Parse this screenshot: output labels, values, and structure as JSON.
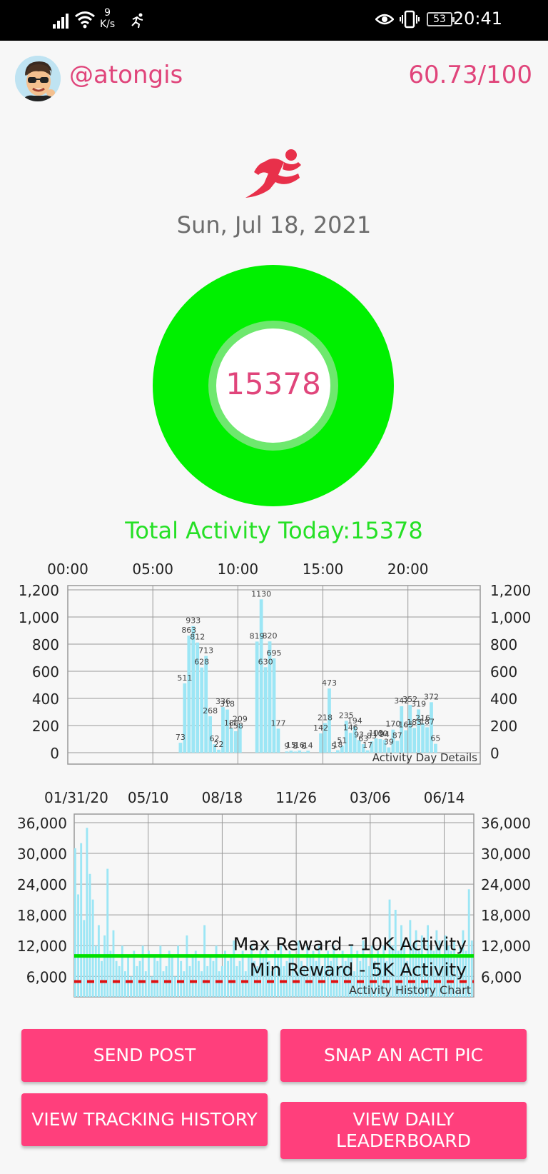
{
  "status_bar": {
    "net_speed_value": "9",
    "net_speed_unit": "K/s",
    "battery": "53",
    "time": "20:41",
    "icons": [
      "signal-icon",
      "wifi-icon",
      "running-notification-icon",
      "eye-icon",
      "vibrate-icon",
      "battery-icon"
    ]
  },
  "header": {
    "username": "@atongis",
    "score": "60.73/100",
    "avatar_icon": "avatar-cartoon-face"
  },
  "activity_icon": "running-person-icon",
  "date": "Sun, Jul 18, 2021",
  "ring": {
    "value": "15378",
    "color": "#00f000",
    "inner_color": "#6ee86e"
  },
  "total_label": "Total Activity Today:15378",
  "colors": {
    "accent": "#ff3f7c",
    "text_pink": "#e0457b",
    "green": "#25e025",
    "bar": "#9ce6f5",
    "red_dash": "#e01010"
  },
  "chart_data": [
    {
      "type": "bar",
      "caption": "Activity Day Details",
      "x_ticks": [
        "00:00",
        "05:00",
        "10:00",
        "15:00",
        "20:00"
      ],
      "y_ticks": [
        "1,200",
        "1,000",
        "800",
        "600",
        "400",
        "200",
        "0"
      ],
      "ylim": [
        0,
        1200
      ],
      "grid": true,
      "values": [
        0,
        0,
        0,
        0,
        0,
        0,
        0,
        0,
        0,
        0,
        0,
        0,
        0,
        0,
        0,
        0,
        0,
        0,
        0,
        0,
        0,
        0,
        0,
        0,
        0,
        0,
        73,
        511,
        863,
        933,
        812,
        628,
        713,
        268,
        62,
        22,
        336,
        318,
        180,
        158,
        209,
        0,
        0,
        0,
        819,
        1130,
        630,
        820,
        695,
        177,
        0,
        9,
        15,
        8,
        16,
        6,
        14,
        0,
        0,
        142,
        218,
        473,
        5,
        18,
        51,
        235,
        146,
        194,
        93,
        63,
        17,
        83,
        105,
        100,
        94,
        39,
        170,
        87,
        342,
        165,
        352,
        183,
        319,
        216,
        187,
        372,
        65,
        0,
        0,
        0,
        0,
        0,
        0,
        0,
        0,
        0,
        0
      ],
      "labels": [
        {
          "i": 26,
          "t": "73"
        },
        {
          "i": 27,
          "t": "511"
        },
        {
          "i": 28,
          "t": "863"
        },
        {
          "i": 29,
          "t": "933"
        },
        {
          "i": 30,
          "t": "812"
        },
        {
          "i": 31,
          "t": "628"
        },
        {
          "i": 32,
          "t": "713"
        },
        {
          "i": 33,
          "t": "268"
        },
        {
          "i": 34,
          "t": "62"
        },
        {
          "i": 35,
          "t": "22"
        },
        {
          "i": 36,
          "t": "336"
        },
        {
          "i": 37,
          "t": "318"
        },
        {
          "i": 38,
          "t": "180"
        },
        {
          "i": 39,
          "t": "158"
        },
        {
          "i": 40,
          "t": "209"
        },
        {
          "i": 44,
          "t": "819"
        },
        {
          "i": 45,
          "t": "1130"
        },
        {
          "i": 46,
          "t": "630"
        },
        {
          "i": 47,
          "t": "820"
        },
        {
          "i": 48,
          "t": "695"
        },
        {
          "i": 49,
          "t": "177"
        },
        {
          "i": 51,
          "t": "9"
        },
        {
          "i": 52,
          "t": "15"
        },
        {
          "i": 53,
          "t": "8"
        },
        {
          "i": 54,
          "t": "16"
        },
        {
          "i": 55,
          "t": "6"
        },
        {
          "i": 56,
          "t": "14"
        },
        {
          "i": 59,
          "t": "142"
        },
        {
          "i": 60,
          "t": "218"
        },
        {
          "i": 61,
          "t": "473"
        },
        {
          "i": 62,
          "t": "5"
        },
        {
          "i": 63,
          "t": "18"
        },
        {
          "i": 64,
          "t": "51"
        },
        {
          "i": 65,
          "t": "235"
        },
        {
          "i": 66,
          "t": "146"
        },
        {
          "i": 67,
          "t": "194"
        },
        {
          "i": 68,
          "t": "93"
        },
        {
          "i": 69,
          "t": "63"
        },
        {
          "i": 70,
          "t": "17"
        },
        {
          "i": 71,
          "t": "83"
        },
        {
          "i": 72,
          "t": "105"
        },
        {
          "i": 73,
          "t": "100"
        },
        {
          "i": 74,
          "t": "94"
        },
        {
          "i": 75,
          "t": "39"
        },
        {
          "i": 76,
          "t": "170"
        },
        {
          "i": 77,
          "t": "87"
        },
        {
          "i": 78,
          "t": "342"
        },
        {
          "i": 79,
          "t": "165"
        },
        {
          "i": 80,
          "t": "352"
        },
        {
          "i": 81,
          "t": "183"
        },
        {
          "i": 82,
          "t": "319"
        },
        {
          "i": 83,
          "t": "216"
        },
        {
          "i": 84,
          "t": "187"
        },
        {
          "i": 85,
          "t": "372"
        },
        {
          "i": 86,
          "t": "65"
        }
      ]
    },
    {
      "type": "bar",
      "caption": "Activity History Chart",
      "x_ticks": [
        "01/31/20",
        "05/10",
        "08/18",
        "11/26",
        "03/06",
        "06/14"
      ],
      "y_ticks": [
        "36,000",
        "30,000",
        "24,000",
        "18,000",
        "12,000",
        "6,000"
      ],
      "ylim": [
        2000,
        36000
      ],
      "grid": true,
      "reference_lines": [
        {
          "label": "Max Reward - 10K Activity",
          "value": 10000,
          "style": "solid",
          "color": "#00e000"
        },
        {
          "label": "Min Reward - 5K Activity",
          "value": 5000,
          "style": "dashed",
          "color": "#e01010"
        }
      ],
      "values": [
        31000,
        22000,
        32000,
        17000,
        35000,
        26000,
        21000,
        12000,
        16000,
        9000,
        14000,
        27000,
        11000,
        15000,
        9000,
        8000,
        12000,
        7000,
        10000,
        6000,
        11000,
        8000,
        9000,
        12000,
        7000,
        11000,
        6000,
        10000,
        9000,
        12000,
        7000,
        8000,
        11000,
        10000,
        6000,
        12000,
        9000,
        7000,
        14000,
        8000,
        10000,
        11000,
        9000,
        7000,
        16000,
        8000,
        10000,
        9000,
        12000,
        7000,
        8000,
        11000,
        9000,
        10000,
        13000,
        8000,
        9000,
        11000,
        7000,
        10000,
        12000,
        9000,
        8000,
        11000,
        10000,
        12000,
        9000,
        7000,
        11000,
        10000,
        12000,
        8000,
        9000,
        11000,
        10000,
        7000,
        13000,
        9000,
        8000,
        12000,
        10000,
        11000,
        9000,
        12000,
        8000,
        10000,
        11000,
        9000,
        12000,
        10000,
        8000,
        11000,
        9000,
        10000,
        12000,
        7000,
        11000,
        9000,
        13000,
        10000,
        8000,
        12000,
        9000,
        11000,
        10000,
        12000,
        9000,
        21000,
        12000,
        19000,
        11000,
        16000,
        13000,
        9000,
        17000,
        12000,
        15000,
        11000,
        14000,
        10000,
        16000,
        12000,
        11000,
        15000,
        13000,
        10000,
        14000,
        12000,
        11000,
        13000,
        10000,
        12000,
        15000,
        11000,
        23000,
        13000
      ]
    }
  ],
  "buttons": {
    "send_post": "SEND POST",
    "snap_pic": "SNAP AN ACTI PIC",
    "view_history": "VIEW TRACKING HISTORY",
    "view_leaderboard_line1": "VIEW DAILY",
    "view_leaderboard_line2": "LEADERBOARD"
  }
}
